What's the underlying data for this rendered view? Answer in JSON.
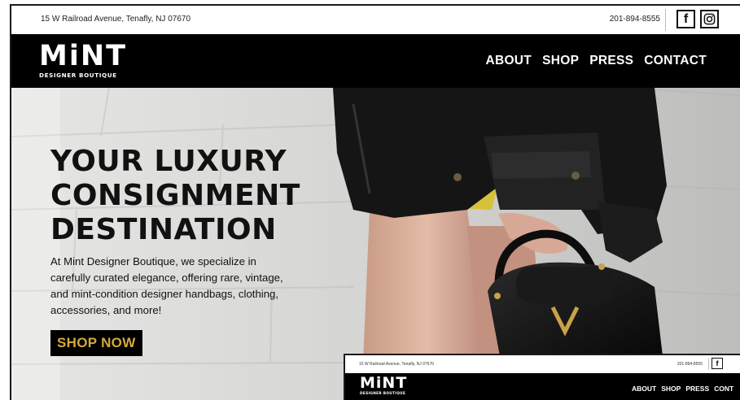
{
  "topbar": {
    "address": "15 W Railroad Avenue, Tenafly, NJ 07670",
    "phone": "201-894-8555",
    "social": {
      "facebook_icon": "facebook-icon",
      "instagram_icon": "instagram-icon"
    }
  },
  "header": {
    "logo_mark": "MiNT",
    "logo_sub": "DESIGNER BOUTIQUE",
    "nav": [
      "ABOUT",
      "SHOP",
      "PRESS",
      "CONTACT"
    ]
  },
  "hero": {
    "title_lines": [
      "YOUR LUXURY",
      "CONSIGNMENT",
      "DESTINATION"
    ],
    "text": "At Mint Designer Boutique, we specialize in carefully curated elegance, offering rare, vintage, and mint-condition designer handbags, clothing, accessories, and more!",
    "cta": "SHOP NOW"
  },
  "preview": {
    "address": "15 W Railroad Avenue, Tenafly, NJ 07670",
    "phone": "201-894-8555",
    "logo_mark": "MiNT",
    "logo_sub": "DESIGNER BOUTIQUE",
    "nav": [
      "ABOUT",
      "SHOP",
      "PRESS",
      "CONT"
    ],
    "fb_glyph": "f"
  },
  "colors": {
    "header_bg": "#000000",
    "cta_text": "#d4a93a",
    "page_bg": "#ffffff"
  }
}
